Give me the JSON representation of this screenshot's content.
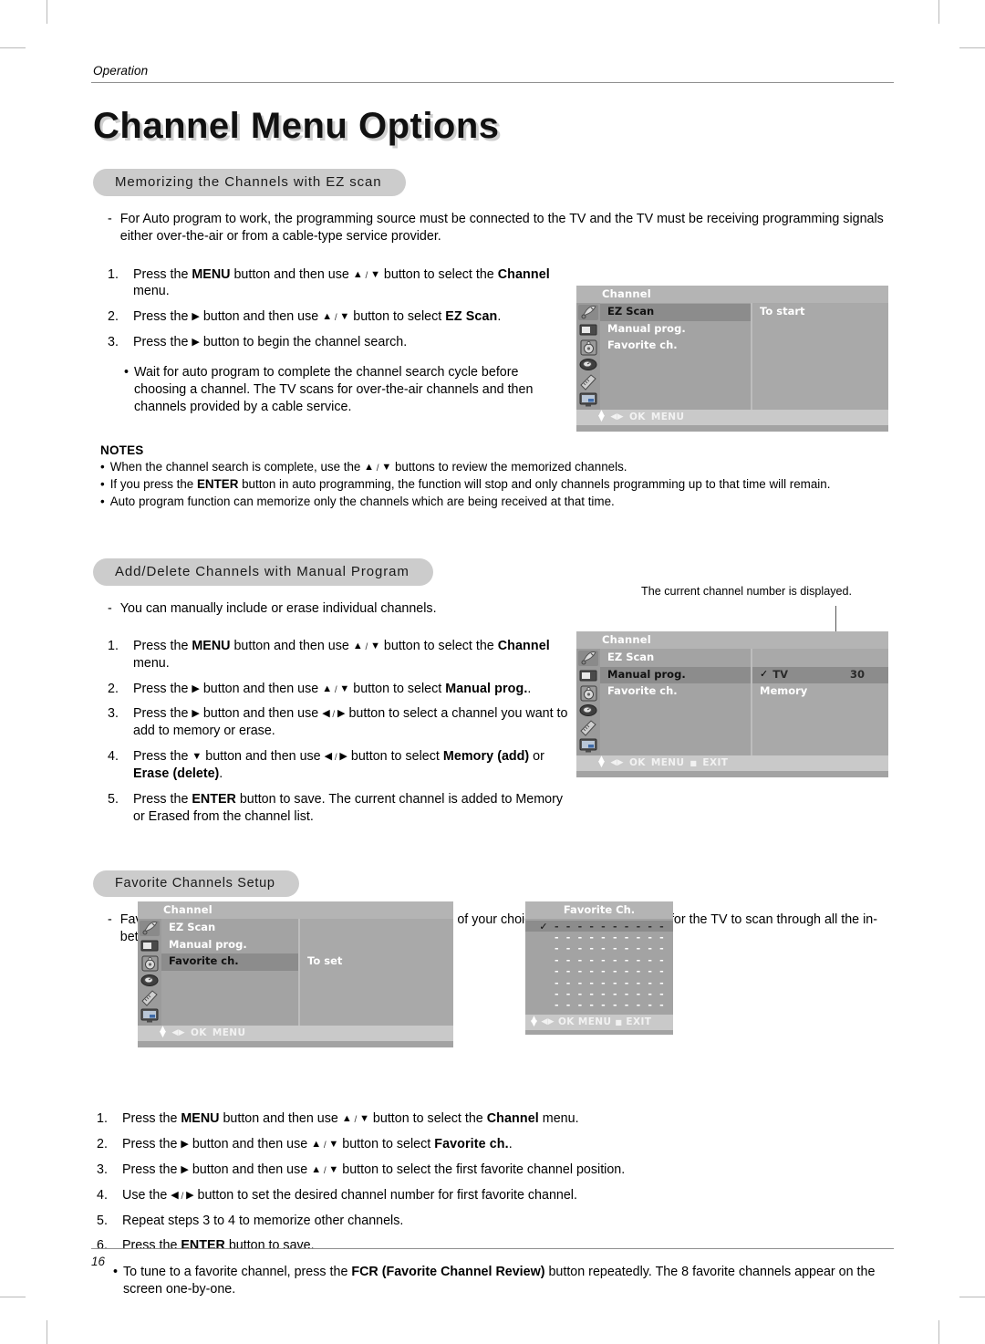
{
  "page": {
    "running_head": "Operation",
    "title": "Channel Menu Options",
    "folio": "16"
  },
  "section_ez": {
    "heading": "Memorizing the Channels with EZ scan",
    "intro_marker": "-",
    "intro": "For Auto program to work, the programming source must be connected to the TV and the TV must be receiving programming signals either over-the-air or from a cable-type service provider.",
    "steps": [
      {
        "num": "1.",
        "pre": "Press the ",
        "b1": "MENU",
        "mid": " button and then use ",
        "up": "▲",
        "sep": " / ",
        "down": "▼",
        "mid2": " button to select the ",
        "b2": "Channel",
        "post": " menu."
      },
      {
        "num": "2.",
        "pre": "Press the ",
        "b1": "▶",
        "mid": "  button and then use ",
        "up": "▲",
        "sep": " / ",
        "down": "▼",
        "mid2": " button to select ",
        "b2": "EZ Scan",
        "post": "."
      },
      {
        "num": "3.",
        "pre": "Press the ",
        "b1": "▶",
        "mid": " button to begin the channel search.",
        "up": "",
        "sep": "",
        "down": "",
        "mid2": "",
        "b2": "",
        "post": ""
      }
    ],
    "bullet": "Wait for auto program to complete the channel search cycle before choosing a channel. The TV scans for over-the-air channels and then channels provided by a cable service.",
    "bullet_marker": "•"
  },
  "notes": {
    "title": "NOTES",
    "marker": "•",
    "items": [
      {
        "pre": "When the channel search is complete, use the ",
        "up": "▲",
        "sep": " / ",
        "down": "▼",
        "post": " buttons to review the memorized channels."
      },
      {
        "pre": "If you press the ",
        "bold": "ENTER",
        "post": " button in auto programming, the function will stop and only channels programming up to that time will remain."
      },
      {
        "pre": "Auto program function can memorize only the channels which are being received at that time."
      }
    ]
  },
  "section_manual": {
    "heading": "Add/Delete Channels with Manual Program",
    "intro_marker": "-",
    "intro": "You can manually include or erase individual channels.",
    "steps": [
      {
        "num": "1.",
        "text": "Press the MENU button and then use ▲ / ▼ button to select the Channel menu."
      },
      {
        "num": "2.",
        "text": "Press the ▶ button and then use ▲ / ▼ button to select Manual prog.."
      },
      {
        "num": "3.",
        "text": "Press the ▶ button and then use ◀ / ▶ button to select a channel you want to add to memory or erase."
      },
      {
        "num": "4.",
        "text": "Press the ▼ button and then use ◀ / ▶ button to select Memory (add) or Erase (delete)."
      },
      {
        "num": "5.",
        "text": "Press the ENTER button to save. The current channel is added to Memory or Erased from the channel list."
      }
    ],
    "callout": "The current channel number is displayed."
  },
  "section_favorite": {
    "heading": "Favorite Channels Setup",
    "intro_marker": "-",
    "intro": "Favorite Channel lets you quickly tune in up to 8 channels of your choice without having to wait for the TV to scan through all the in-between channels.",
    "steps": [
      {
        "num": "1.",
        "text": "Press the MENU button and then use ▲ / ▼ button to select the Channel menu."
      },
      {
        "num": "2.",
        "text": "Press the ▶ button and then use ▲ / ▼ button to select Favorite ch.."
      },
      {
        "num": "3.",
        "text": "Press the ▶ button and then use ▲ / ▼ button to select the first favorite channel position."
      },
      {
        "num": "4.",
        "text": "Use the ◀ / ▶ button to set the desired channel number for first favorite channel."
      },
      {
        "num": "5.",
        "text": "Repeat steps 3 to 4 to memorize other channels."
      },
      {
        "num": "6.",
        "text": "Press the ENTER button to save."
      }
    ],
    "bullet_marker": "•",
    "bullet": "To tune to a favorite channel, press the FCR (Favorite Channel Review) button repeatedly. The 8 favorite channels appear on the screen one-by-one."
  },
  "osd1": {
    "title": "Channel",
    "menu_items": [
      "EZ Scan",
      "Manual prog.",
      "Favorite ch."
    ],
    "selected_index": 0,
    "detail": [
      "To start"
    ],
    "nav": {
      "ok": "OK",
      "menu": "MENU"
    },
    "icons": [
      "satellite-dish-icon",
      "picture-screen-icon",
      "audio-disc-icon",
      "clock-timer-icon",
      "remote-control-icon",
      "pc-monitor-icon"
    ]
  },
  "osd2": {
    "title": "Channel",
    "menu_items": [
      "EZ Scan",
      "Manual prog.",
      "Favorite ch."
    ],
    "selected_index": 1,
    "detail_selected": {
      "check": "✓",
      "label": "TV",
      "value": "30"
    },
    "detail_second": "Memory",
    "nav": {
      "ok": "OK",
      "menu": "MENU",
      "exit": "EXIT"
    },
    "icons": [
      "satellite-dish-icon",
      "picture-screen-icon",
      "audio-disc-icon",
      "clock-timer-icon",
      "remote-control-icon",
      "pc-monitor-icon"
    ]
  },
  "osd3": {
    "title": "Channel",
    "menu_items": [
      "EZ Scan",
      "Manual prog.",
      "Favorite ch."
    ],
    "selected_index": 2,
    "detail": [
      "To set"
    ],
    "nav": {
      "ok": "OK",
      "menu": "MENU"
    },
    "icons": [
      "satellite-dish-icon",
      "picture-screen-icon",
      "audio-disc-icon",
      "clock-timer-icon",
      "remote-control-icon",
      "pc-monitor-icon"
    ]
  },
  "osd_fav": {
    "title": "Favorite Ch.",
    "check": "✓",
    "dashes": "- - - - - - - - - -",
    "row_count": 8,
    "selected_index": 0,
    "nav": {
      "ok": "OK",
      "menu": "MENU",
      "exit": "EXIT"
    }
  },
  "colors": {
    "osd_bg": "#a3a3a3",
    "osd_title_bg": "#b4b4b4",
    "osd_selected": "#8c8c8c",
    "osd_nav_bg": "#c9c9c9",
    "pill_bg": "#cccccc",
    "rule": "#8f8f8f"
  }
}
